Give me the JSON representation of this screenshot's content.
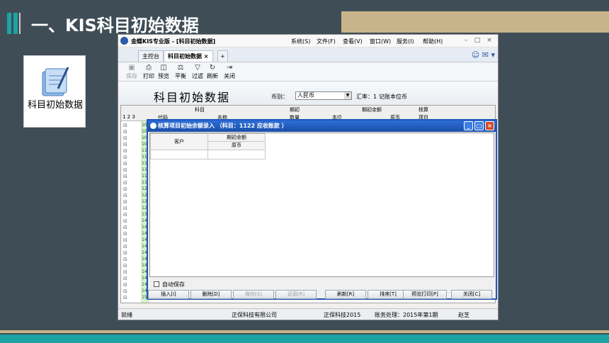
{
  "slide": {
    "title": "一、KIS科目初始数据",
    "icon_card_label": "科目初始数据"
  },
  "app": {
    "title": "金蝶KIS专业版 - [科目初始数据]",
    "menus": [
      "系统(S)",
      "文件(F)",
      "查看(V)",
      "窗口(W)",
      "服务(I)",
      "帮助(H)"
    ],
    "tabs": [
      "主控台",
      "科目初始数据"
    ],
    "toolbar": [
      "保存",
      "打印",
      "预览",
      "平衡",
      "过滤",
      "刷新",
      "关闭"
    ],
    "page_title": "科目初始数据",
    "currency_label": "币别：",
    "currency_value": "人民币",
    "rate_text": "汇率：1",
    "base_currency_note": "记账本位币",
    "grid_headers": {
      "levels": "1 2 3",
      "subject": "科目",
      "code": "代码",
      "name": "名称",
      "opening": "期初",
      "quantity": "数量",
      "opening_balance": "期初余额",
      "original": "原币",
      "credit": "本位",
      "check": "核算",
      "check_item": "项目"
    },
    "row_codes": [
      "10",
      "10",
      "10",
      "10",
      "11",
      "11",
      "11",
      "11",
      "11",
      "11",
      "12",
      "12",
      "12",
      "12",
      "13",
      "14",
      "14",
      "14",
      "14",
      "14",
      "14",
      "14",
      "14",
      "14",
      "14",
      "14",
      "14",
      "15"
    ],
    "status": {
      "ready": "就绪",
      "company": "正保科技有限公司",
      "account_set": "正保科技2015",
      "period": "账务处理：2015年第1期",
      "user": "赵芝"
    }
  },
  "dialog": {
    "title": "核算项目初始余额录入 （科目：1122 应收账款 ）",
    "col_customer": "客户",
    "col_opening_balance": "期初余额",
    "col_original": "原币",
    "autosave_label": "自动保存",
    "buttons": [
      "插入[I]",
      "删除[D]",
      "保存[S]",
      "还原[R]",
      "刷新[R]",
      "排序[T]",
      "预览打印[P]",
      "关闭[C]"
    ]
  }
}
